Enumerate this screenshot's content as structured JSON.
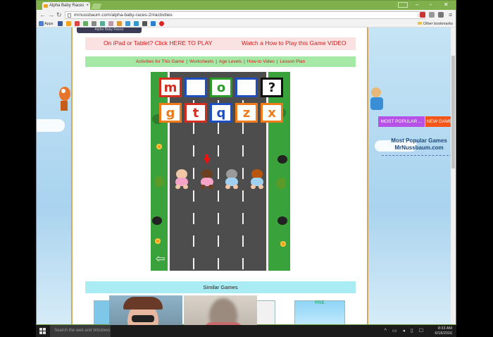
{
  "browser": {
    "tab_title": "Alpha Baby Races",
    "url": "mrnussbaum.com/alpha-baby-races-2/#activities",
    "apps_label": "Apps",
    "other_bookmarks": "Other bookmarks",
    "window_controls": [
      "–",
      "▫",
      "✕"
    ]
  },
  "page": {
    "game_title_tab": "Alpha Baby Races",
    "play_links": [
      {
        "label": "On iPad or Tablet? Click HERE TO PLAY"
      },
      {
        "label": "Watch a How to Play this Game VIDEO"
      }
    ],
    "activity_links": [
      "Activities for This Game",
      "Worksheets",
      "Age Levels",
      "How-to Video",
      "Lesson Plan"
    ],
    "similar_games": "Similar Games",
    "similar_thumb_label": "FIVE"
  },
  "game": {
    "top_tiles": [
      {
        "letter": "m",
        "color": "red"
      },
      {
        "letter": "",
        "color": "blue"
      },
      {
        "letter": "o",
        "color": "green"
      },
      {
        "letter": "",
        "color": "blue"
      },
      {
        "letter": "?",
        "color": "black"
      }
    ],
    "choice_tiles": [
      {
        "letter": "g",
        "color": "orange"
      },
      {
        "letter": "t",
        "color": "red"
      },
      {
        "letter": "q",
        "color": "blue"
      },
      {
        "letter": "z",
        "color": "orange"
      },
      {
        "letter": "x",
        "color": "orange"
      }
    ],
    "back_icon": "left-arrow-icon"
  },
  "sidebar": {
    "tab_popular": "MOST POPULAR ...",
    "tab_new": "NEW GAME",
    "heading_line1": "Most Popular Games",
    "heading_line2": "MrNussbaum.com"
  },
  "taskbar": {
    "search_placeholder": "Search the web and Windows",
    "time": "8:33 AM",
    "date": "6/18/2016"
  }
}
